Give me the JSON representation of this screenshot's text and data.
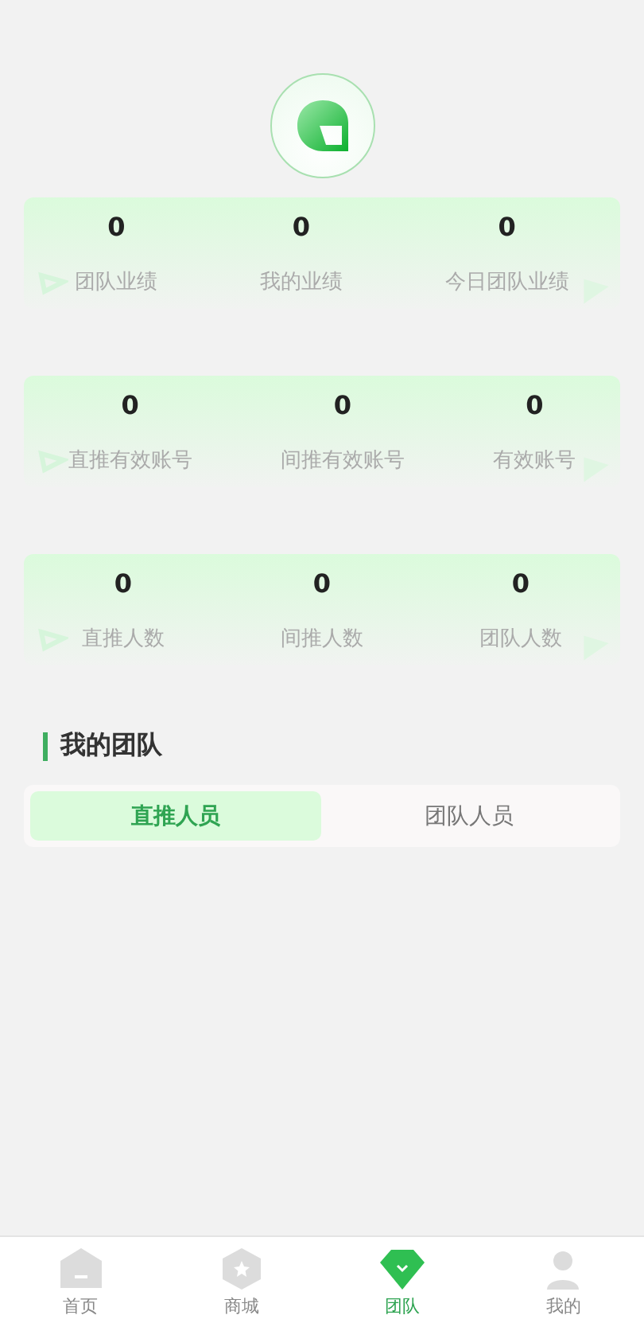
{
  "stat_cards": [
    {
      "stats": [
        {
          "value": "0",
          "label": "团队业绩"
        },
        {
          "value": "0",
          "label": "我的业绩"
        },
        {
          "value": "0",
          "label": "今日团队业绩"
        }
      ]
    },
    {
      "stats": [
        {
          "value": "0",
          "label": "直推有效账号"
        },
        {
          "value": "0",
          "label": "间推有效账号"
        },
        {
          "value": "0",
          "label": "有效账号"
        }
      ]
    },
    {
      "stats": [
        {
          "value": "0",
          "label": "直推人数"
        },
        {
          "value": "0",
          "label": "间推人数"
        },
        {
          "value": "0",
          "label": "团队人数"
        }
      ]
    }
  ],
  "section_title": "我的团队",
  "tabs": [
    {
      "label": "直推人员",
      "selected": true
    },
    {
      "label": "团队人员",
      "selected": false
    }
  ],
  "tab_bar": [
    {
      "kind": "home",
      "label": "首页",
      "selected": false
    },
    {
      "kind": "shop",
      "label": "商城",
      "selected": false
    },
    {
      "kind": "team",
      "label": "团队",
      "selected": true
    },
    {
      "kind": "mine",
      "label": "我的",
      "selected": false
    }
  ]
}
